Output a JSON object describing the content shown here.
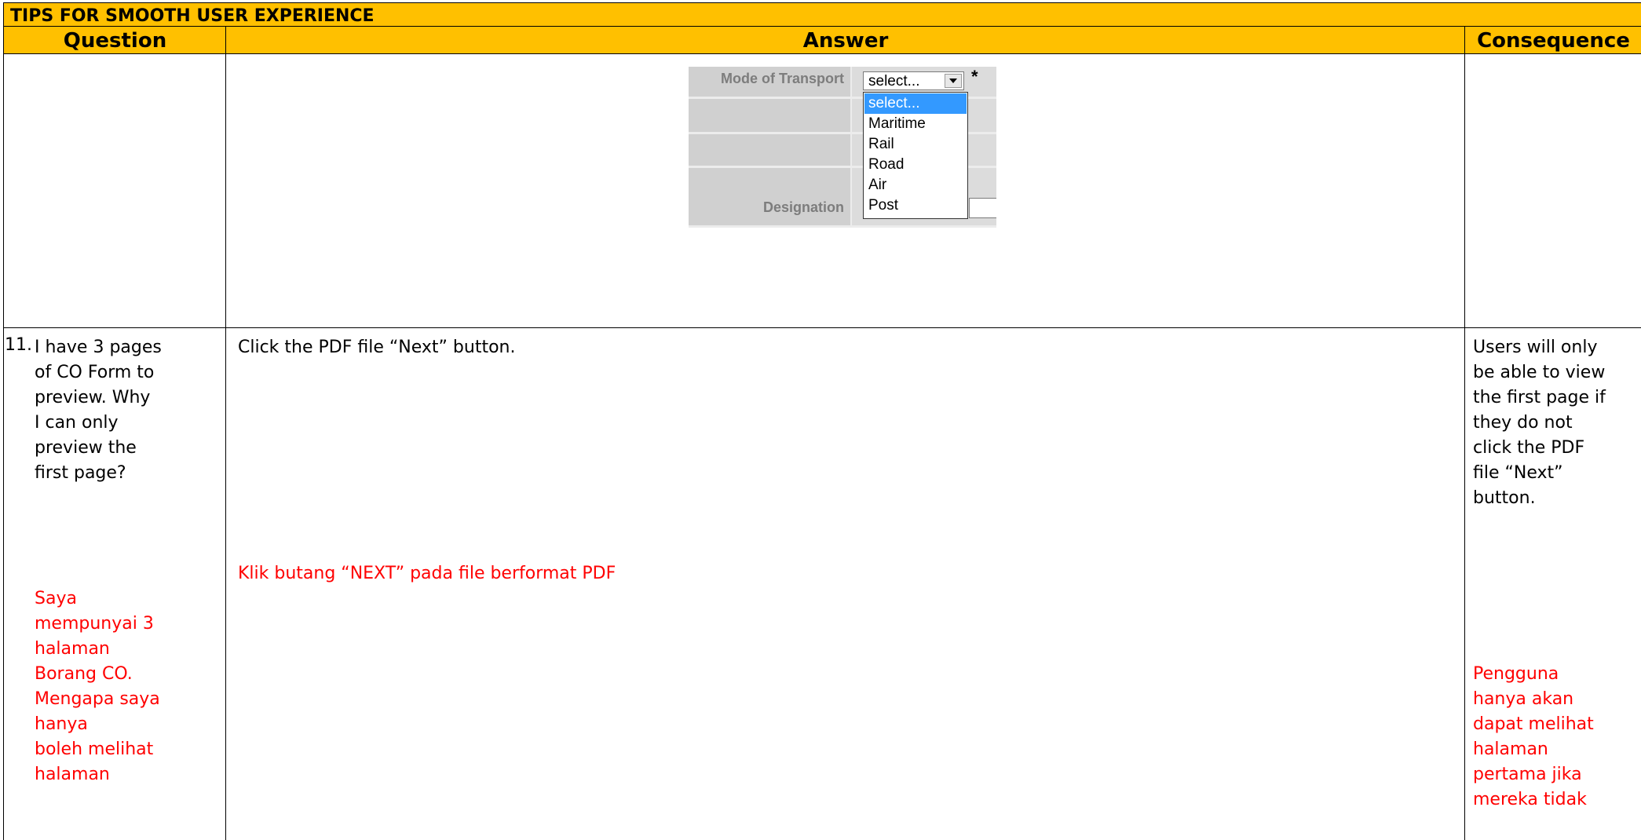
{
  "document": {
    "title": "TIPS FOR SMOOTH USER EXPERIENCE",
    "columns": {
      "question": "Question",
      "answer": "Answer",
      "consequence": "Consequence"
    }
  },
  "embedded_form": {
    "mode_label": "Mode of Transport",
    "designation_label": "Designation",
    "select_value": "select...",
    "required_mark": "*",
    "options": [
      "select...",
      "Maritime",
      "Rail",
      "Road",
      "Air",
      "Post"
    ]
  },
  "row11": {
    "number": "11.",
    "question_en_lines": [
      "I have 3 pages",
      "of CO Form to",
      "preview. Why",
      "I can only",
      "preview the",
      "first page?"
    ],
    "question_ms_lines": [
      "Saya",
      "mempunyai 3",
      "halaman",
      "Borang CO.",
      "Mengapa saya",
      "hanya",
      "boleh melihat",
      "halaman"
    ],
    "answer_en": "Click the PDF file “Next” button.",
    "answer_ms": "Klik  butang “NEXT” pada file berformat PDF",
    "consequence_en_lines": [
      "Users will only",
      "be able to view",
      "the first page if",
      "they do not",
      "click the PDF",
      "file “Next”",
      "button."
    ],
    "consequence_ms_lines": [
      "Pengguna",
      "hanya akan",
      "dapat melihat",
      "halaman",
      "pertama jika",
      "mereka tidak"
    ]
  }
}
